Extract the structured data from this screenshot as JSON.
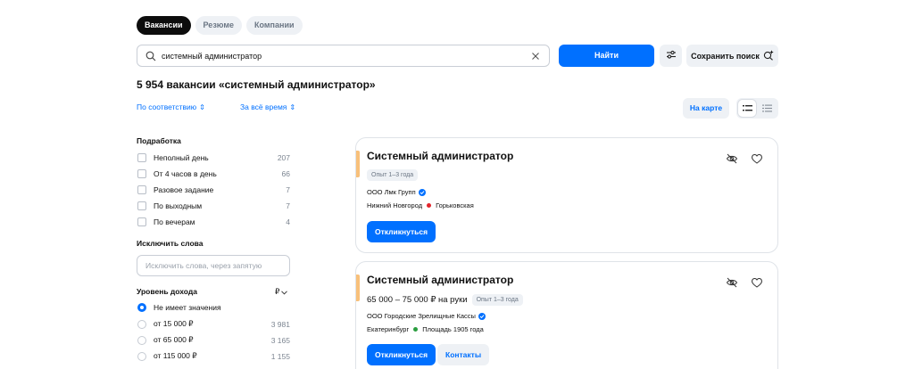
{
  "tabs": [
    {
      "label": "Вакансии",
      "active": true
    },
    {
      "label": "Резюме",
      "active": false
    },
    {
      "label": "Компании",
      "active": false
    }
  ],
  "search": {
    "value": "системный администратор",
    "placeholder": ""
  },
  "find_button": "Найти",
  "save_search_button": "Сохранить поиск",
  "results_title": "5 954 вакансии «системный администратор»",
  "sort": {
    "relevance": "По соответствию",
    "period": "За всё время",
    "arrow": "⇕"
  },
  "map_button": "На карте",
  "filters": {
    "part_time": {
      "title": "Подработка",
      "items": [
        {
          "label": "Неполный день",
          "count": "207"
        },
        {
          "label": "От 4 часов в день",
          "count": "66"
        },
        {
          "label": "Разовое задание",
          "count": "7"
        },
        {
          "label": "По выходным",
          "count": "7"
        },
        {
          "label": "По вечерам",
          "count": "4"
        }
      ]
    },
    "exclude": {
      "title": "Исключить слова",
      "placeholder": "Исключить слова, через запятую"
    },
    "income": {
      "title": "Уровень дохода",
      "currency": "₽",
      "items": [
        {
          "label": "Не имеет значения",
          "count": "",
          "selected": true
        },
        {
          "label": "от 15 000 ₽",
          "count": "3 981",
          "selected": false
        },
        {
          "label": "от 65 000 ₽",
          "count": "3 165",
          "selected": false
        },
        {
          "label": "от 115 000 ₽",
          "count": "1 155",
          "selected": false
        }
      ]
    }
  },
  "vacancies": [
    {
      "title": "Системный администратор",
      "salary": "",
      "experience": "Опыт 1–3 года",
      "company": "ООО Лмк Групп",
      "city": "Нижний Новгород",
      "metro": "Горьковская",
      "metro_color": "#e3242b",
      "apply": "Откликнуться"
    },
    {
      "title": "Системный администратор",
      "salary": "65 000 – 75 000 ₽ на руки",
      "experience": "Опыт 1–3 года",
      "company": "ООО Городские Зрелищные Кассы",
      "city": "Екатеринбург",
      "metro": "Площадь 1905 года",
      "metro_color": "#2a9d3f",
      "apply": "Откликнуться",
      "contacts": "Контакты"
    }
  ],
  "colors": {
    "accent": "#0070ff",
    "dark_tab": "#0d0d0d",
    "card_accent": "#f8c07a"
  }
}
